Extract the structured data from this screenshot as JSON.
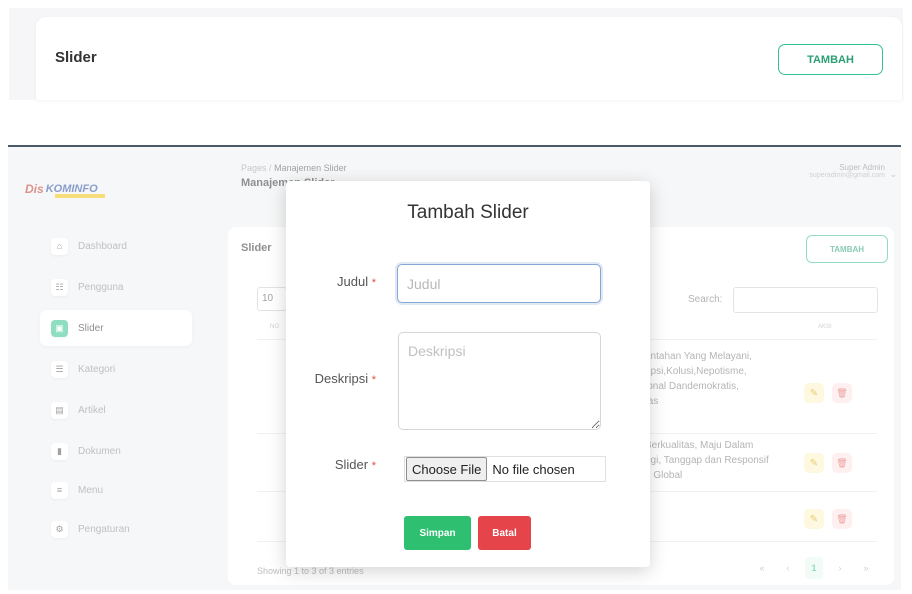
{
  "top_card": {
    "title": "Slider",
    "add_label": "TAMBAH"
  },
  "app": {
    "logo": {
      "part1": "Dis",
      "part2": "KOMINFO"
    },
    "sidebar": {
      "items": [
        {
          "label": "Dashboard",
          "icon": "home-icon",
          "glyph": "⌂"
        },
        {
          "label": "Pengguna",
          "icon": "users-icon",
          "glyph": "☷"
        },
        {
          "label": "Slider",
          "icon": "image-icon",
          "glyph": "▣"
        },
        {
          "label": "Kategori",
          "icon": "list-icon",
          "glyph": "☰"
        },
        {
          "label": "Artikel",
          "icon": "article-icon",
          "glyph": "▤"
        },
        {
          "label": "Dokumen",
          "icon": "document-icon",
          "glyph": "▮"
        },
        {
          "label": "Menu",
          "icon": "menu-icon",
          "glyph": "≡"
        },
        {
          "label": "Pengaturan",
          "icon": "settings-icon",
          "glyph": "⚙"
        }
      ],
      "active_index": 2
    },
    "breadcrumb": {
      "root": "Pages",
      "sep": "/",
      "current": "Manajemen Slider"
    },
    "page_title": "Manajemen Slider",
    "user": {
      "name": "Super Admin",
      "email": "superadmin@gmail.com"
    },
    "panel": {
      "title": "Slider",
      "add_label": "TAMBAH",
      "page_length": "10",
      "search_label": "Search:",
      "col_no": "NO",
      "col_action": "AKSI",
      "rows": [
        {
          "lines": [
            "rintahan Yang Melayani,",
            "upsi,Kolusi,Nepotisme,",
            "ional Dandemokratis,",
            "tas"
          ]
        },
        {
          "lines": [
            "Berkualitas, Maju Dalam",
            "ogi, Tanggap dan Responsif",
            "n Global"
          ]
        },
        {
          "lines": []
        }
      ],
      "showing": "Showing 1 to 3 of 3 entries",
      "pagination": [
        "«",
        "‹",
        "1",
        "›",
        "»"
      ]
    }
  },
  "modal": {
    "title": "Tambah Slider",
    "judul": {
      "label": "Judul",
      "placeholder": "Judul",
      "value": ""
    },
    "deskripsi": {
      "label": "Deskripsi",
      "placeholder": "Deskripsi",
      "value": ""
    },
    "slider_file": {
      "label": "Slider",
      "button": "Choose File",
      "status": "No file chosen"
    },
    "required_mark": "*",
    "save_label": "Simpan",
    "cancel_label": "Batal"
  },
  "colors": {
    "accent": "#34c38f",
    "save": "#2fbf71",
    "cancel": "#e4444a",
    "required": "#e74c3c"
  }
}
